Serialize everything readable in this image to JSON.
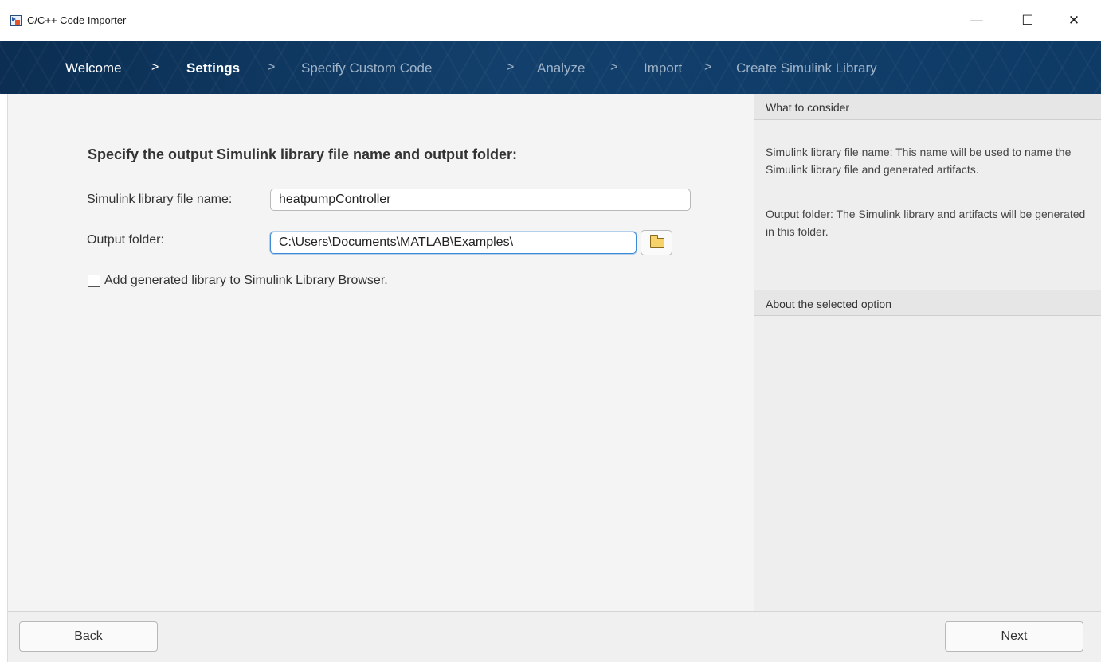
{
  "window": {
    "title": "C/C++ Code Importer",
    "controls": {
      "minimize": "—",
      "maximize": "☐",
      "close": "✕"
    }
  },
  "breadcrumb": {
    "steps": [
      "Welcome",
      "Settings",
      "Specify Custom Code",
      "Analyze",
      "Import",
      "Create Simulink Library"
    ],
    "separator": ">",
    "active_step": "Settings"
  },
  "main": {
    "heading": "Specify the output Simulink library file name and output folder:",
    "library_name_label": "Simulink library file name:",
    "library_name_value": "heatpumpController",
    "output_folder_label": "Output folder:",
    "output_folder_value": "C:\\Users\\Documents\\MATLAB\\Examples\\",
    "add_to_browser_label": "Add generated library to Simulink Library Browser.",
    "add_to_browser_checked": false
  },
  "panel": {
    "consider_title": "What to consider",
    "consider_text_1": "Simulink library file name: This name will be used to name the Simulink library file and generated artifacts.",
    "consider_text_2": "Output folder: The Simulink library and artifacts will be generated in this folder.",
    "about_title": "About the selected option"
  },
  "footer": {
    "back_label": "Back",
    "next_label": "Next"
  },
  "icons": [
    "app-icon",
    "folder-icon",
    "minimize-icon",
    "maximize-icon",
    "close-icon"
  ],
  "colors": {
    "nav_band": "#123f6b",
    "focus_border": "#3d89d6",
    "inactive_step": "#9fb3c8"
  }
}
